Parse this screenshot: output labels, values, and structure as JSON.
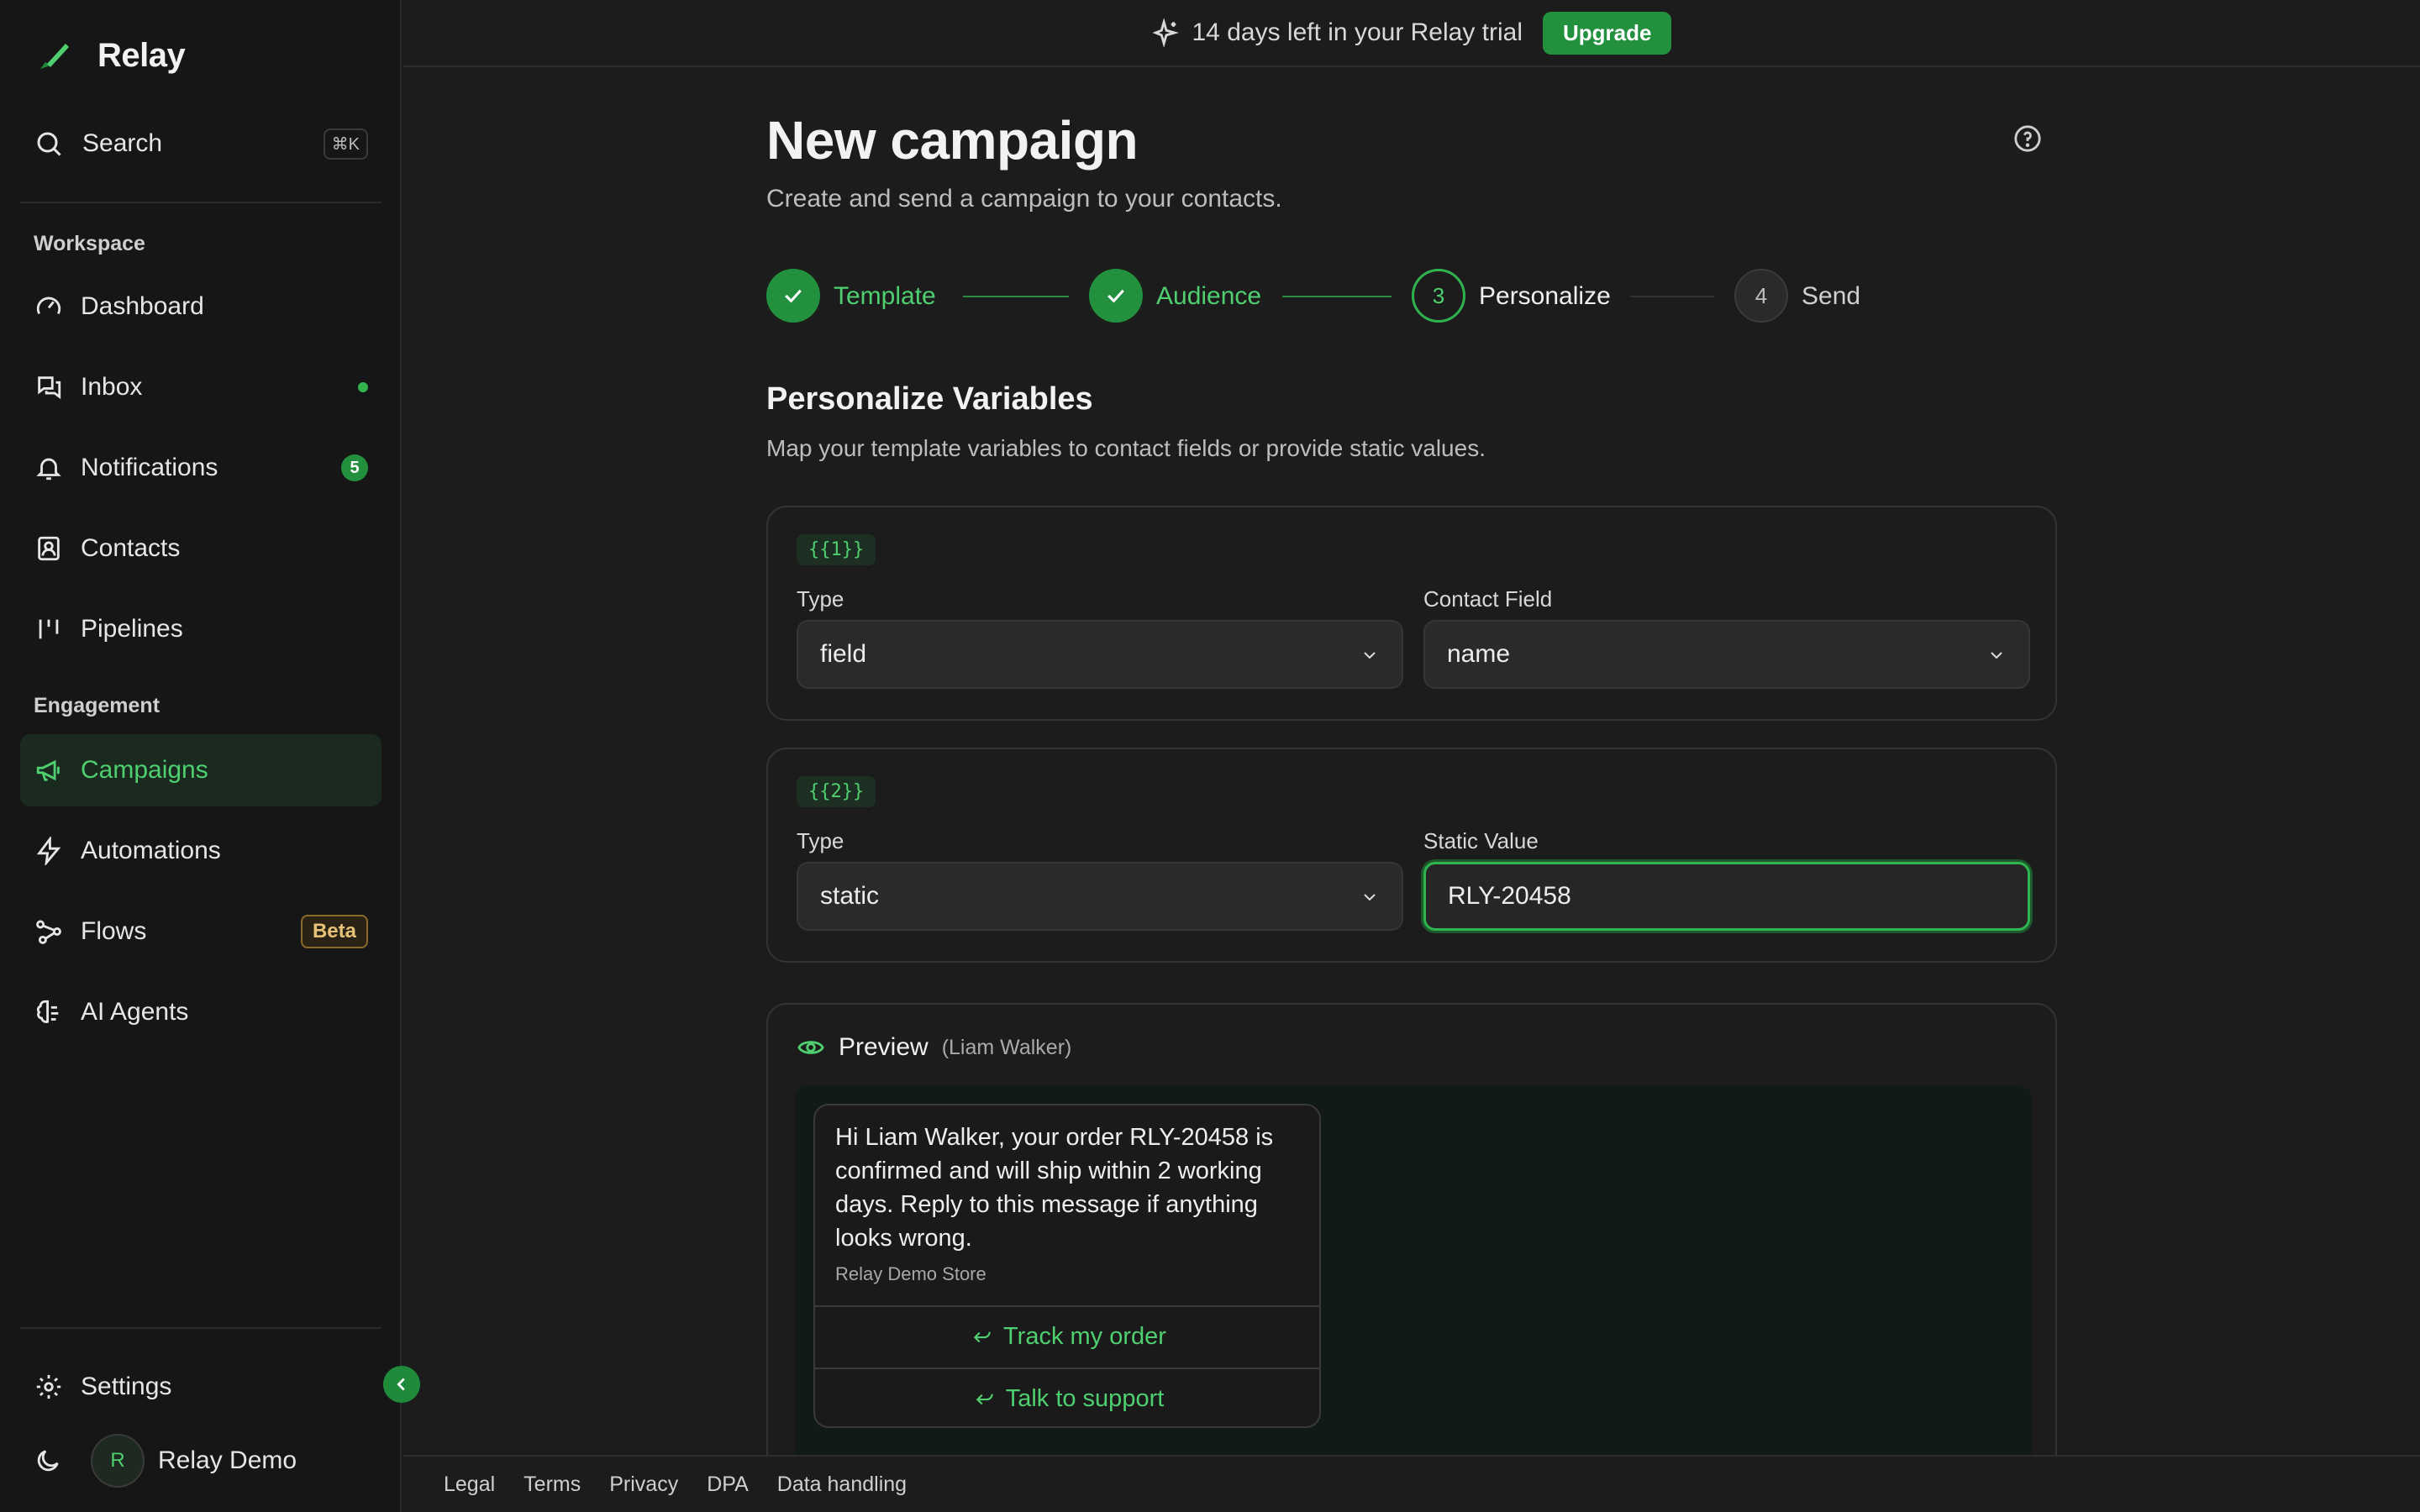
{
  "brand": {
    "name": "Relay",
    "accent": "#2fb44f"
  },
  "sidebar": {
    "search": {
      "label": "Search",
      "shortcut": "⌘K"
    },
    "sections": {
      "workspace": "Workspace",
      "engagement": "Engagement"
    },
    "workspace_items": [
      {
        "label": "Dashboard",
        "icon": "gauge-icon"
      },
      {
        "label": "Inbox",
        "icon": "chat-icon",
        "indicator": "dot"
      },
      {
        "label": "Notifications",
        "icon": "bell-icon",
        "count": "5"
      },
      {
        "label": "Contacts",
        "icon": "contact-card-icon"
      },
      {
        "label": "Pipelines",
        "icon": "pipeline-icon"
      }
    ],
    "engagement_items": [
      {
        "label": "Campaigns",
        "icon": "megaphone-icon",
        "active": true
      },
      {
        "label": "Automations",
        "icon": "lightning-icon"
      },
      {
        "label": "Flows",
        "icon": "flow-icon",
        "badge": "Beta"
      },
      {
        "label": "AI Agents",
        "icon": "brain-icon"
      }
    ],
    "settings": "Settings",
    "user": {
      "initial": "R",
      "name": "Relay Demo"
    }
  },
  "banner": {
    "text": "14 days left in your Relay trial",
    "button": "Upgrade"
  },
  "page": {
    "title": "New campaign",
    "subtitle": "Create and send a campaign to your contacts."
  },
  "steps": [
    {
      "label": "Template",
      "state": "done",
      "number": "1"
    },
    {
      "label": "Audience",
      "state": "done",
      "number": "2"
    },
    {
      "label": "Personalize",
      "state": "current",
      "number": "3"
    },
    {
      "label": "Send",
      "state": "future",
      "number": "4"
    }
  ],
  "personalize": {
    "title": "Personalize Variables",
    "description": "Map your template variables to contact fields or provide static values."
  },
  "variables": [
    {
      "tag": "{{1}}",
      "type_label": "Type",
      "type_value": "field",
      "second_label": "Contact Field",
      "second_value": "name",
      "second_kind": "select"
    },
    {
      "tag": "{{2}}",
      "type_label": "Type",
      "type_value": "static",
      "second_label": "Static Value",
      "second_value": "RLY-20458",
      "second_kind": "input"
    }
  ],
  "preview": {
    "title": "Preview",
    "contact": "(Liam Walker)",
    "message": "Hi Liam Walker, your order RLY-20458 is confirmed and will ship within 2 working days. Reply to this message if anything looks wrong.",
    "footer": "Relay Demo Store",
    "buttons": [
      "Track my order",
      "Talk to support"
    ]
  },
  "footer_links": [
    "Legal",
    "Terms",
    "Privacy",
    "DPA",
    "Data handling"
  ]
}
